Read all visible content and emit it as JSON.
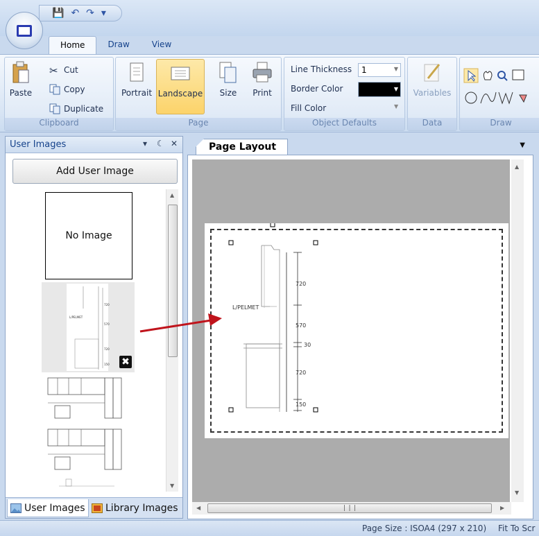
{
  "quick_access": {
    "save": "save-icon",
    "undo": "undo-icon",
    "redo": "redo-icon",
    "more": "▾"
  },
  "tabs": [
    {
      "label": "Home"
    },
    {
      "label": "Draw"
    },
    {
      "label": "View"
    }
  ],
  "ribbon": {
    "clipboard": {
      "paste": "Paste",
      "cut": "Cut",
      "copy": "Copy",
      "duplicate": "Duplicate",
      "group": "Clipboard"
    },
    "page": {
      "portrait": "Portrait",
      "landscape": "Landscape",
      "size": "Size",
      "print": "Print",
      "group": "Page"
    },
    "object_defaults": {
      "line_thickness": "Line Thickness",
      "line_thickness_value": "1",
      "border_color": "Border Color",
      "border_color_value": "#000000",
      "fill_color": "Fill Color",
      "group": "Object Defaults"
    },
    "data": {
      "variables": "Variables",
      "group": "Data"
    },
    "draw": {
      "group": "Draw"
    }
  },
  "left_panel": {
    "title": "User Images",
    "controls": {
      "dropdown": "▾",
      "pin": "ᵖ",
      "close": "✕"
    },
    "add_button": "Add User Image",
    "no_image": "No Image",
    "tabs": [
      {
        "label": "User Images"
      },
      {
        "label": "Library Images"
      }
    ]
  },
  "document": {
    "tab": "Page Layout",
    "drawing": {
      "label": "L/PELMET",
      "dims": [
        "720",
        "570",
        "30",
        "720",
        "150"
      ]
    },
    "thumb_drawing": {
      "label": "L/PELMET",
      "dims": [
        "720",
        "570",
        "720",
        "150"
      ]
    }
  },
  "status_bar": {
    "page_size": "Page Size : ISOA4 (297 x 210)",
    "fit": "Fit To Scr"
  },
  "colors": {
    "accent": "#15428b",
    "arrow": "#c0141c",
    "selected": "#fcd36a"
  }
}
